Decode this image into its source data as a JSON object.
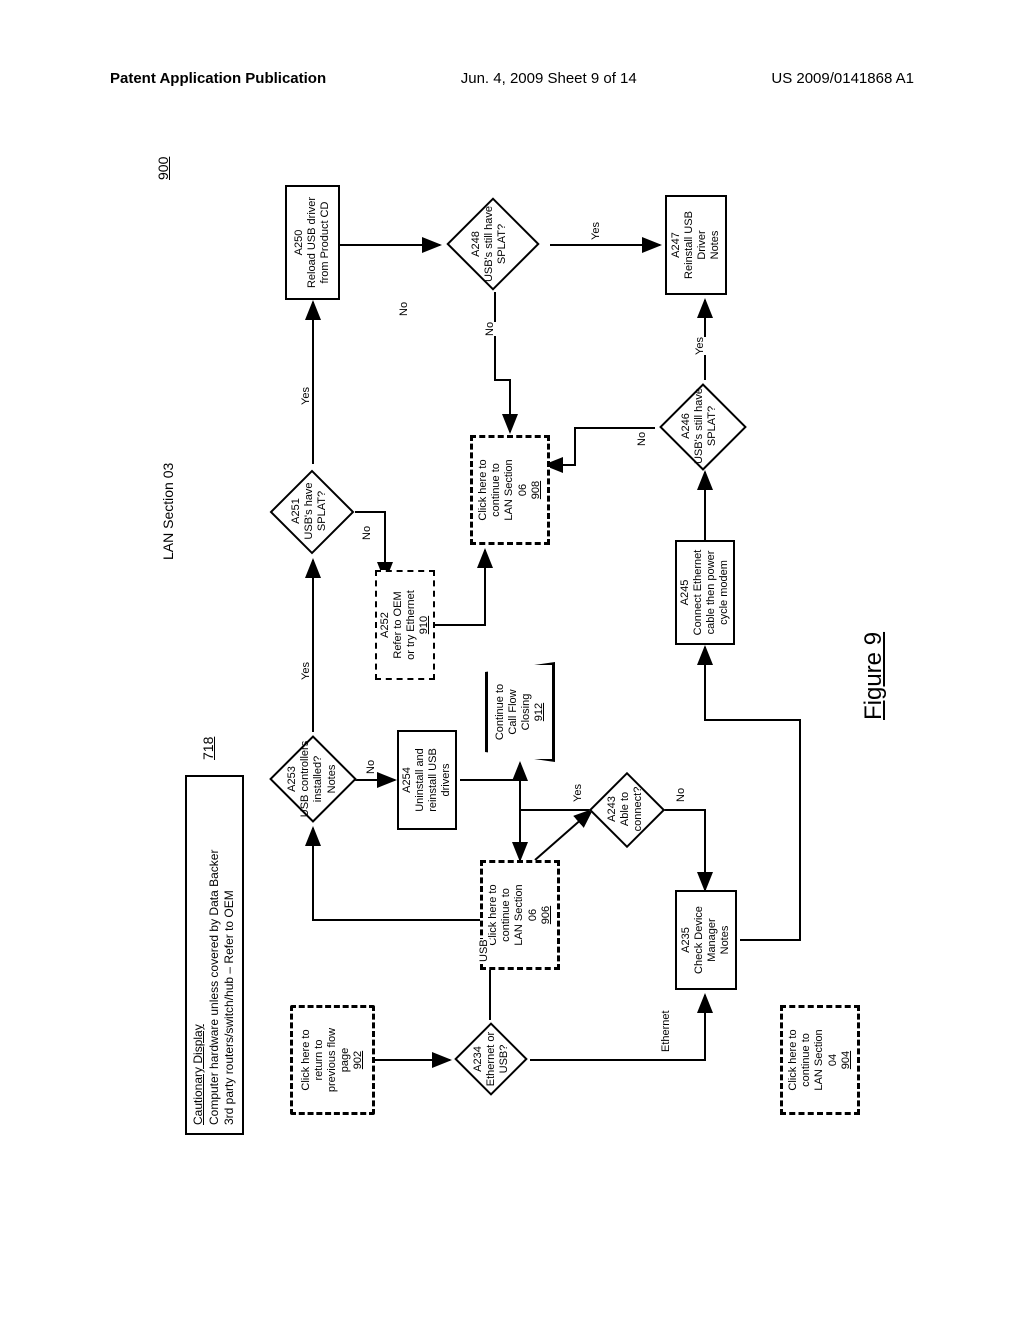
{
  "header": {
    "left": "Patent Application Publication",
    "middle": "Jun. 4, 2009  Sheet 9 of 14",
    "right": "US 2009/0141868 A1"
  },
  "section_title": "LAN Section 03",
  "ref_page": "900",
  "ref_caution": "718",
  "cautionary": {
    "title": "Cautionary Display",
    "line1": "Computer hardware unless covered by Data Backer",
    "line2": "3rd party routers/switch/hub – Refer to OEM"
  },
  "nodes": {
    "n902": {
      "line1": "Click here to",
      "line2": "return to",
      "line3": "previous flow",
      "line4": "page",
      "ref": "902"
    },
    "n906": {
      "line1": "Click here to",
      "line2": "continue to",
      "line3": "LAN Section",
      "line4": "06",
      "ref": "906"
    },
    "n908": {
      "line1": "Click here to",
      "line2": "continue to",
      "line3": "LAN Section",
      "line4": "06",
      "ref": "908"
    },
    "n904": {
      "line1": "Click here to",
      "line2": "continue to",
      "line3": "LAN Section",
      "line4": "04",
      "ref": "904"
    },
    "a234": {
      "code": "A234",
      "line1": "Ethernet or",
      "line2": "USB?"
    },
    "a253": {
      "code": "A253",
      "line1": "USB controllers",
      "line2": "installed?",
      "line3": "Notes"
    },
    "a251": {
      "code": "A251",
      "line1": "USB's have",
      "line2": "SPLAT?"
    },
    "a250": {
      "code": "A250",
      "line1": "Reload USB driver",
      "line2": "from Product CD"
    },
    "a254": {
      "code": "A254",
      "line1": "Uninstall and",
      "line2": "reinstall USB",
      "line3": "drivers"
    },
    "a252": {
      "code": "A252",
      "line1": "Refer to OEM",
      "line2": "or try Ethernet",
      "ref": "910"
    },
    "a243": {
      "code": "A243",
      "line1": "Able to",
      "line2": "connect?"
    },
    "a248": {
      "code": "A248",
      "line1": "USB's still have",
      "line2": "SPLAT?"
    },
    "a235": {
      "code": "A235",
      "line1": "Check Device",
      "line2": "Manager",
      "line3": "Notes"
    },
    "a245": {
      "code": "A245",
      "line1": "Connect Ethernet",
      "line2": "cable then power",
      "line3": "cycle modem"
    },
    "a246": {
      "code": "A246",
      "line1": "USB's still have",
      "line2": "SPLAT?"
    },
    "a247": {
      "code": "A247",
      "line1": "Reinstall USB",
      "line2": "Driver",
      "line3": "Notes"
    },
    "term": {
      "line1": "Continue to",
      "line2": "Call Flow",
      "line3": "Closing",
      "ref": "912"
    }
  },
  "labels": {
    "usb": "USB",
    "ethernet": "Ethernet",
    "yes": "Yes",
    "no": "No"
  },
  "figure_caption": "Figure 9"
}
